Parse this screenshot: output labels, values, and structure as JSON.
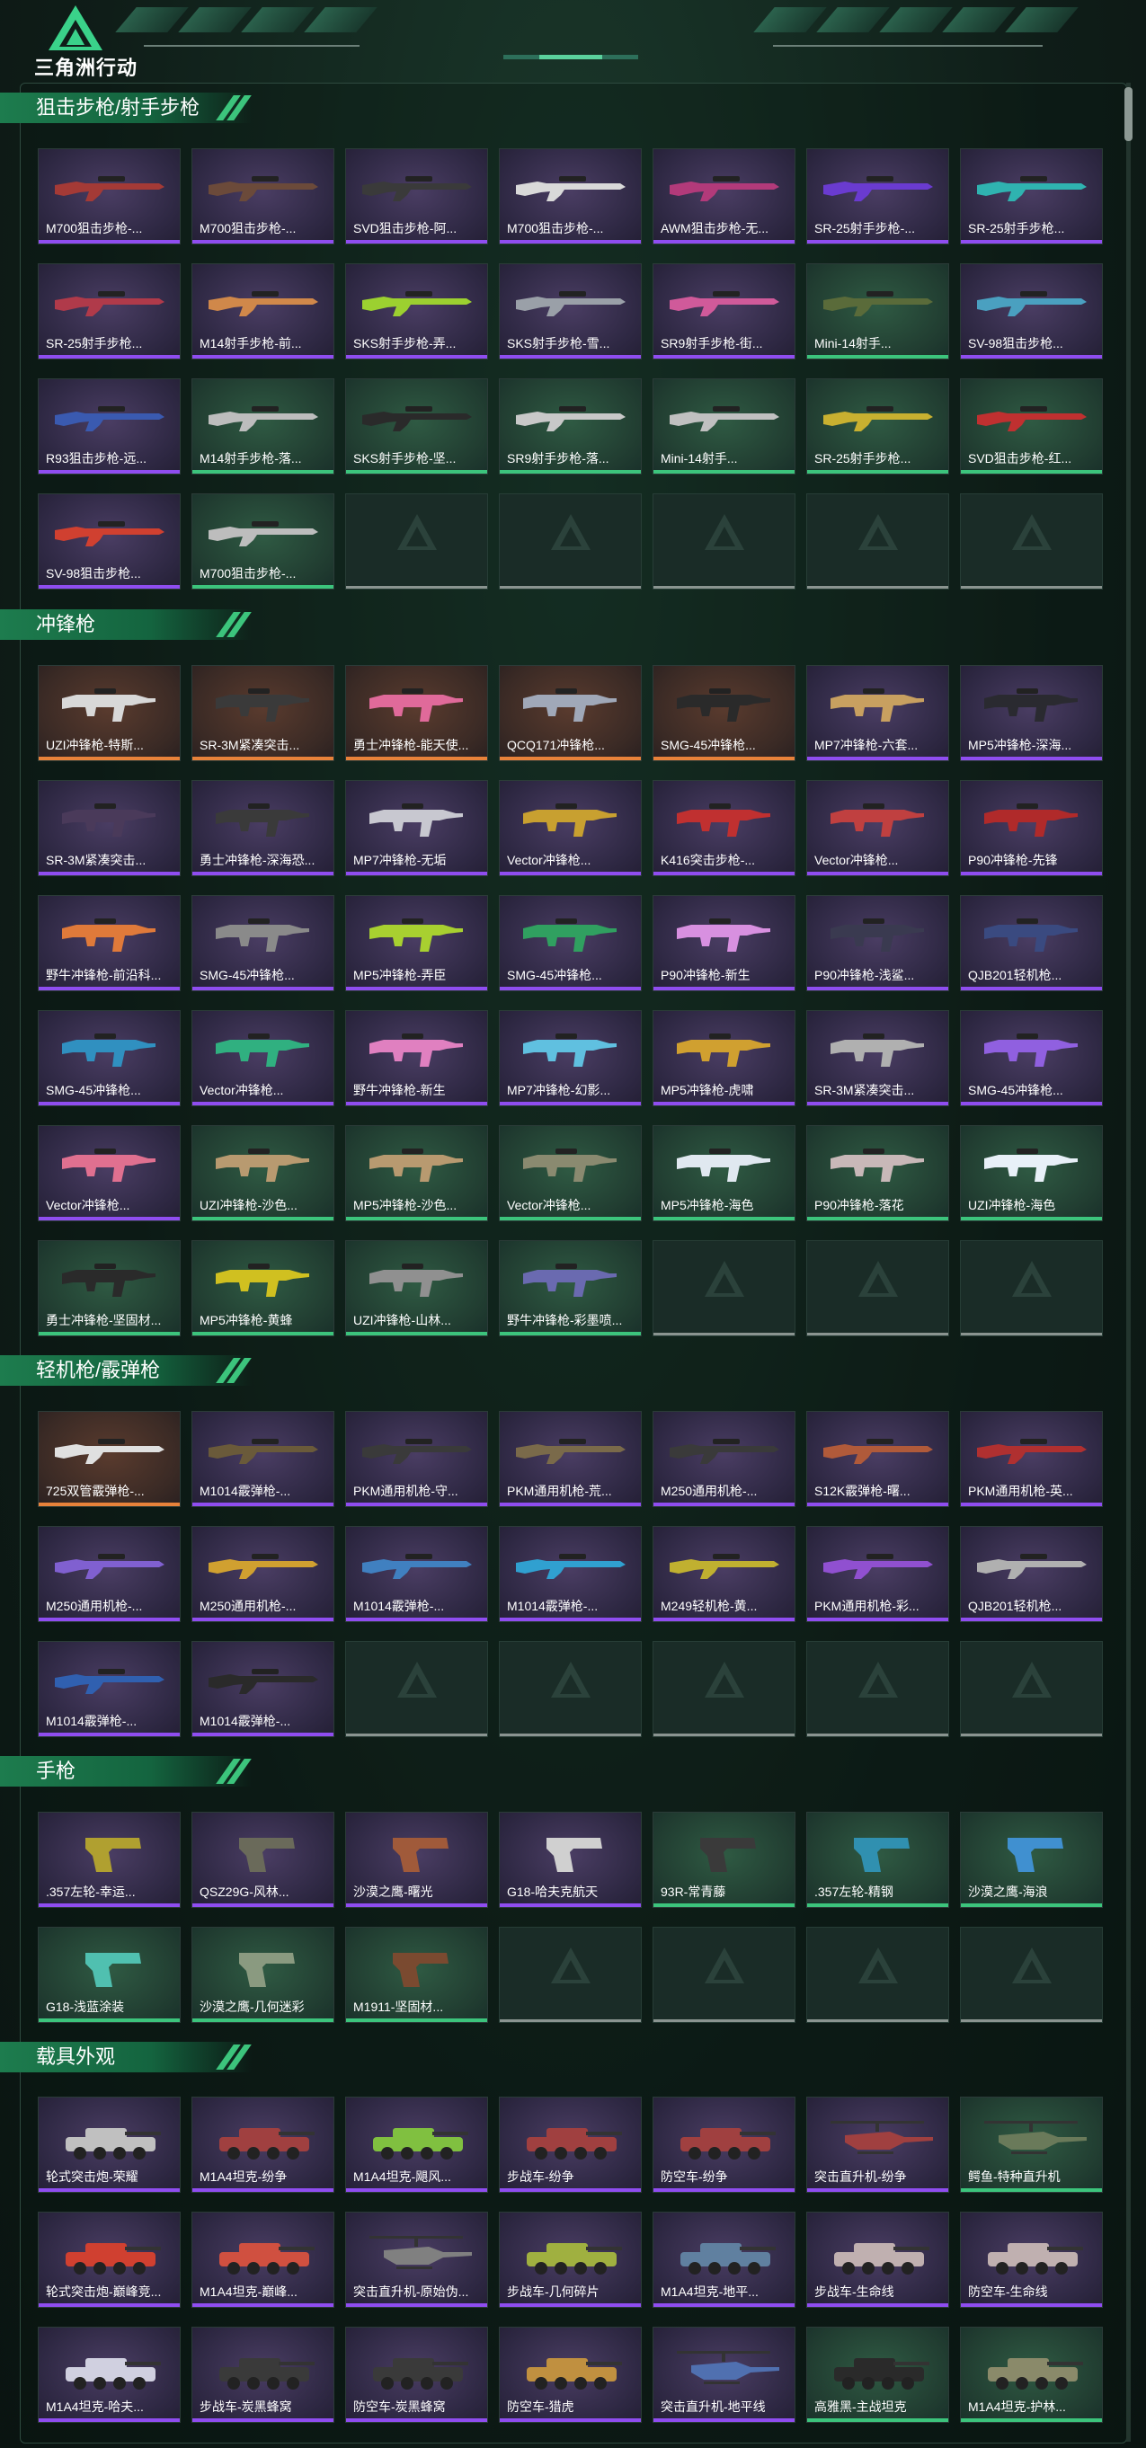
{
  "app": {
    "logo_text": "三角洲行动"
  },
  "colors": {
    "purple": "#8f4df0",
    "orange": "#e8823a",
    "green": "#3cc47c",
    "blue": "#3b6cf0",
    "accent": "#1d7c4e"
  },
  "sections": [
    {
      "title": "狙击步枪/射手步枪",
      "items": [
        {
          "name": "M700狙击步枪-...",
          "rarity": "purple",
          "kind": "rifle",
          "tone": "#a43a36"
        },
        {
          "name": "M700狙击步枪-...",
          "rarity": "purple",
          "kind": "rifle",
          "tone": "#6b4a3a"
        },
        {
          "name": "SVD狙击步枪-阿...",
          "rarity": "purple",
          "kind": "rifle",
          "tone": "#3a3a3a"
        },
        {
          "name": "M700狙击步枪-...",
          "rarity": "purple",
          "kind": "rifle",
          "tone": "#d9d9d9"
        },
        {
          "name": "AWM狙击步枪-无...",
          "rarity": "purple",
          "kind": "rifle",
          "tone": "#b23a7a"
        },
        {
          "name": "SR-25射手步枪-...",
          "rarity": "purple",
          "kind": "rifle",
          "tone": "#6a3bd0"
        },
        {
          "name": "SR-25射手步枪...",
          "rarity": "purple",
          "kind": "rifle",
          "tone": "#2fb3b0"
        },
        {
          "name": "SR-25射手步枪...",
          "rarity": "purple",
          "kind": "rifle",
          "tone": "#b03a4a"
        },
        {
          "name": "M14射手步枪-前...",
          "rarity": "purple",
          "kind": "rifle",
          "tone": "#d0884a"
        },
        {
          "name": "SKS射手步枪-弄...",
          "rarity": "purple",
          "kind": "rifle",
          "tone": "#9cd030"
        },
        {
          "name": "SKS射手步枪-雪...",
          "rarity": "purple",
          "kind": "rifle",
          "tone": "#9aa0a8"
        },
        {
          "name": "SR9射手步枪-街...",
          "rarity": "purple",
          "kind": "rifle",
          "tone": "#d05a9a"
        },
        {
          "name": "Mini-14射手...",
          "rarity": "green",
          "kind": "rifle",
          "tone": "#5a6b3a"
        },
        {
          "name": "SV-98狙击步枪...",
          "rarity": "purple",
          "kind": "rifle",
          "tone": "#4aa0c0"
        },
        {
          "name": "R93狙击步枪-远...",
          "rarity": "purple",
          "kind": "rifle",
          "tone": "#3a5ab0"
        },
        {
          "name": "M14射手步枪-落...",
          "rarity": "green",
          "kind": "rifle",
          "tone": "#bdbdbd"
        },
        {
          "name": "SKS射手步枪-坚...",
          "rarity": "green",
          "kind": "rifle",
          "tone": "#2a2a2a"
        },
        {
          "name": "SR9射手步枪-落...",
          "rarity": "green",
          "kind": "rifle",
          "tone": "#c8c8c8"
        },
        {
          "name": "Mini-14射手...",
          "rarity": "green",
          "kind": "rifle",
          "tone": "#c0c0c0"
        },
        {
          "name": "SR-25射手步枪...",
          "rarity": "green",
          "kind": "rifle",
          "tone": "#c8b030"
        },
        {
          "name": "SVD狙击步枪-红...",
          "rarity": "green",
          "kind": "rifle",
          "tone": "#c03030"
        },
        {
          "name": "SV-98狙击步枪...",
          "rarity": "purple",
          "kind": "rifle",
          "tone": "#d04030"
        },
        {
          "name": "M700狙击步枪-...",
          "rarity": "green",
          "kind": "rifle",
          "tone": "#bdbdbd"
        },
        {
          "empty": true
        },
        {
          "empty": true
        },
        {
          "empty": true
        },
        {
          "empty": true
        },
        {
          "empty": true
        }
      ]
    },
    {
      "title": "冲锋枪",
      "items": [
        {
          "name": "UZI冲锋枪-特斯...",
          "rarity": "orange",
          "kind": "smg",
          "tone": "#d8d8d8"
        },
        {
          "name": "SR-3M紧凑突击...",
          "rarity": "orange",
          "kind": "smg",
          "tone": "#3a3a3a"
        },
        {
          "name": "勇士冲锋枪-能天使...",
          "rarity": "orange",
          "kind": "smg",
          "tone": "#e06a9a"
        },
        {
          "name": "QCQ171冲锋枪...",
          "rarity": "orange",
          "kind": "smg",
          "tone": "#a0a8b8"
        },
        {
          "name": "SMG-45冲锋枪...",
          "rarity": "orange",
          "kind": "smg",
          "tone": "#2a2a2a"
        },
        {
          "name": "MP7冲锋枪-六套...",
          "rarity": "purple",
          "kind": "smg",
          "tone": "#c8a060"
        },
        {
          "name": "MP5冲锋枪-深海...",
          "rarity": "purple",
          "kind": "smg",
          "tone": "#2a2a30"
        },
        {
          "name": "SR-3M紧凑突击...",
          "rarity": "purple",
          "kind": "smg",
          "tone": "#4a3a5a"
        },
        {
          "name": "勇士冲锋枪-深海恐...",
          "rarity": "purple",
          "kind": "smg",
          "tone": "#3a3a3a"
        },
        {
          "name": "MP7冲锋枪-无垢",
          "rarity": "purple",
          "kind": "smg",
          "tone": "#c8c8d0"
        },
        {
          "name": "Vector冲锋枪...",
          "rarity": "purple",
          "kind": "smg",
          "tone": "#c8a030"
        },
        {
          "name": "K416突击步枪-...",
          "rarity": "purple",
          "kind": "smg",
          "tone": "#c03030"
        },
        {
          "name": "Vector冲锋枪...",
          "rarity": "purple",
          "kind": "smg",
          "tone": "#c04040"
        },
        {
          "name": "P90冲锋枪-先锋",
          "rarity": "purple",
          "kind": "smg",
          "tone": "#b02a2a"
        },
        {
          "name": "野牛冲锋枪-前沿科...",
          "rarity": "purple",
          "kind": "smg",
          "tone": "#e07a3a"
        },
        {
          "name": "SMG-45冲锋枪...",
          "rarity": "purple",
          "kind": "smg",
          "tone": "#8a8a8a"
        },
        {
          "name": "MP5冲锋枪-弄臣",
          "rarity": "purple",
          "kind": "smg",
          "tone": "#a8d030"
        },
        {
          "name": "SMG-45冲锋枪...",
          "rarity": "purple",
          "kind": "smg",
          "tone": "#30a060"
        },
        {
          "name": "P90冲锋枪-新生",
          "rarity": "purple",
          "kind": "smg",
          "tone": "#d890e0"
        },
        {
          "name": "P90冲锋枪-浅鲨...",
          "rarity": "purple",
          "kind": "smg",
          "tone": "#3a3a50"
        },
        {
          "name": "QJB201轻机枪...",
          "rarity": "purple",
          "kind": "smg",
          "tone": "#3a4a80"
        },
        {
          "name": "SMG-45冲锋枪...",
          "rarity": "purple",
          "kind": "smg",
          "tone": "#3090c0"
        },
        {
          "name": "Vector冲锋枪...",
          "rarity": "purple",
          "kind": "smg",
          "tone": "#30b080"
        },
        {
          "name": "野牛冲锋枪-新生",
          "rarity": "purple",
          "kind": "smg",
          "tone": "#e080c0"
        },
        {
          "name": "MP7冲锋枪-幻影...",
          "rarity": "purple",
          "kind": "smg",
          "tone": "#60c0e0"
        },
        {
          "name": "MP5冲锋枪-虎啸",
          "rarity": "purple",
          "kind": "smg",
          "tone": "#d0a030"
        },
        {
          "name": "SR-3M紧凑突击...",
          "rarity": "purple",
          "kind": "smg",
          "tone": "#b0b0b0"
        },
        {
          "name": "SMG-45冲锋枪...",
          "rarity": "purple",
          "kind": "smg",
          "tone": "#9060e0"
        },
        {
          "name": "Vector冲锋枪...",
          "rarity": "purple",
          "kind": "smg",
          "tone": "#e07090"
        },
        {
          "name": "UZI冲锋枪-沙色...",
          "rarity": "green",
          "kind": "smg",
          "tone": "#b89a70"
        },
        {
          "name": "MP5冲锋枪-沙色...",
          "rarity": "green",
          "kind": "smg",
          "tone": "#b89a70"
        },
        {
          "name": "Vector冲锋枪...",
          "rarity": "green",
          "kind": "smg",
          "tone": "#8a8a70"
        },
        {
          "name": "MP5冲锋枪-海色",
          "rarity": "green",
          "kind": "smg",
          "tone": "#e0e8f0"
        },
        {
          "name": "P90冲锋枪-落花",
          "rarity": "green",
          "kind": "smg",
          "tone": "#c8b8b8"
        },
        {
          "name": "UZI冲锋枪-海色",
          "rarity": "green",
          "kind": "smg",
          "tone": "#e8f0f8"
        },
        {
          "name": "勇士冲锋枪-坚固材...",
          "rarity": "green",
          "kind": "smg",
          "tone": "#2a2a2a"
        },
        {
          "name": "MP5冲锋枪-黄蜂",
          "rarity": "green",
          "kind": "smg",
          "tone": "#d0c020"
        },
        {
          "name": "UZI冲锋枪-山林...",
          "rarity": "green",
          "kind": "smg",
          "tone": "#909090"
        },
        {
          "name": "野牛冲锋枪-彩墨喷...",
          "rarity": "green",
          "kind": "smg",
          "tone": "#6a6ab0"
        },
        {
          "empty": true
        },
        {
          "empty": true
        },
        {
          "empty": true
        }
      ]
    },
    {
      "title": "轻机枪/霰弹枪",
      "items": [
        {
          "name": "725双管霰弹枪-...",
          "rarity": "orange",
          "kind": "rifle",
          "tone": "#e0e0e0"
        },
        {
          "name": "M1014霰弹枪-...",
          "rarity": "purple",
          "kind": "rifle",
          "tone": "#6a5a3a"
        },
        {
          "name": "PKM通用机枪-守...",
          "rarity": "purple",
          "kind": "rifle",
          "tone": "#3a3a3a"
        },
        {
          "name": "PKM通用机枪-荒...",
          "rarity": "purple",
          "kind": "rifle",
          "tone": "#7a6a4a"
        },
        {
          "name": "M250通用机枪-...",
          "rarity": "purple",
          "kind": "rifle",
          "tone": "#3a3a3a"
        },
        {
          "name": "S12K霰弹枪-曙...",
          "rarity": "purple",
          "kind": "rifle",
          "tone": "#b05a3a"
        },
        {
          "name": "PKM通用机枪-英...",
          "rarity": "purple",
          "kind": "rifle",
          "tone": "#b03030"
        },
        {
          "name": "M250通用机枪-...",
          "rarity": "purple",
          "kind": "rifle",
          "tone": "#8060d0"
        },
        {
          "name": "M250通用机枪-...",
          "rarity": "purple",
          "kind": "rifle",
          "tone": "#d0a030"
        },
        {
          "name": "M1014霰弹枪-...",
          "rarity": "purple",
          "kind": "rifle",
          "tone": "#4080c0"
        },
        {
          "name": "M1014霰弹枪-...",
          "rarity": "purple",
          "kind": "rifle",
          "tone": "#30a0d0"
        },
        {
          "name": "M249轻机枪-黄...",
          "rarity": "purple",
          "kind": "rifle",
          "tone": "#c0b030"
        },
        {
          "name": "PKM通用机枪-彩...",
          "rarity": "purple",
          "kind": "rifle",
          "tone": "#9050d0"
        },
        {
          "name": "QJB201轻机枪...",
          "rarity": "purple",
          "kind": "rifle",
          "tone": "#b0b0b0"
        },
        {
          "name": "M1014霰弹枪-...",
          "rarity": "purple",
          "kind": "rifle",
          "tone": "#3060b0"
        },
        {
          "name": "M1014霰弹枪-...",
          "rarity": "purple",
          "kind": "rifle",
          "tone": "#2a2a2a"
        },
        {
          "empty": true
        },
        {
          "empty": true
        },
        {
          "empty": true
        },
        {
          "empty": true
        },
        {
          "empty": true
        }
      ]
    },
    {
      "title": "手枪",
      "items": [
        {
          "name": ".357左轮-幸运...",
          "rarity": "purple",
          "kind": "pistol",
          "tone": "#b0a030"
        },
        {
          "name": "QSZ29G-风林...",
          "rarity": "purple",
          "kind": "pistol",
          "tone": "#6a6a5a"
        },
        {
          "name": "沙漠之鹰-曙光",
          "rarity": "purple",
          "kind": "pistol",
          "tone": "#a05a3a"
        },
        {
          "name": "G18-哈夫克航天",
          "rarity": "purple",
          "kind": "pistol",
          "tone": "#d0d0d0"
        },
        {
          "name": "93R-常青藤",
          "rarity": "green",
          "kind": "pistol",
          "tone": "#3a3a3a"
        },
        {
          "name": ".357左轮-精钢",
          "rarity": "green",
          "kind": "pistol",
          "tone": "#3090b0"
        },
        {
          "name": "沙漠之鹰-海浪",
          "rarity": "green",
          "kind": "pistol",
          "tone": "#4090d0"
        },
        {
          "name": "G18-浅蓝涂装",
          "rarity": "green",
          "kind": "pistol",
          "tone": "#50c0b0"
        },
        {
          "name": "沙漠之鹰-几何迷彩",
          "rarity": "green",
          "kind": "pistol",
          "tone": "#8a9a80"
        },
        {
          "name": "M1911-坚固材...",
          "rarity": "green",
          "kind": "pistol",
          "tone": "#7a4a30"
        },
        {
          "empty": true
        },
        {
          "empty": true
        },
        {
          "empty": true
        },
        {
          "empty": true
        }
      ]
    },
    {
      "title": "载具外观",
      "items": [
        {
          "name": "轮式突击炮-荣耀",
          "rarity": "purple",
          "kind": "vehicle",
          "tone": "#c0c0c0"
        },
        {
          "name": "M1A4坦克-纷争",
          "rarity": "purple",
          "kind": "vehicle",
          "tone": "#a04040"
        },
        {
          "name": "M1A4坦克-飓风...",
          "rarity": "purple",
          "kind": "vehicle",
          "tone": "#80c040"
        },
        {
          "name": "步战车-纷争",
          "rarity": "purple",
          "kind": "vehicle",
          "tone": "#a04040"
        },
        {
          "name": "防空车-纷争",
          "rarity": "purple",
          "kind": "vehicle",
          "tone": "#a04040"
        },
        {
          "name": "突击直升机-纷争",
          "rarity": "purple",
          "kind": "heli",
          "tone": "#a04040"
        },
        {
          "name": "鳄鱼-特种直升机",
          "rarity": "green",
          "kind": "heli",
          "tone": "#6a7a5a"
        },
        {
          "name": "轮式突击炮-巅峰竞...",
          "rarity": "purple",
          "kind": "vehicle",
          "tone": "#d04030"
        },
        {
          "name": "M1A4坦克-巅峰...",
          "rarity": "purple",
          "kind": "vehicle",
          "tone": "#d05040"
        },
        {
          "name": "突击直升机-原始伪...",
          "rarity": "purple",
          "kind": "heli",
          "tone": "#808080"
        },
        {
          "name": "步战车-几何碎片",
          "rarity": "purple",
          "kind": "vehicle",
          "tone": "#a0b040"
        },
        {
          "name": "M1A4坦克-地平...",
          "rarity": "purple",
          "kind": "vehicle",
          "tone": "#6080a0"
        },
        {
          "name": "步战车-生命线",
          "rarity": "purple",
          "kind": "vehicle",
          "tone": "#c0b0b0"
        },
        {
          "name": "防空车-生命线",
          "rarity": "purple",
          "kind": "vehicle",
          "tone": "#c0b0b0"
        },
        {
          "name": "M1A4坦克-哈夫...",
          "rarity": "purple",
          "kind": "vehicle",
          "tone": "#d0d0e0"
        },
        {
          "name": "步战车-炭黑蜂窝",
          "rarity": "purple",
          "kind": "vehicle",
          "tone": "#3a3a3a"
        },
        {
          "name": "防空车-炭黑蜂窝",
          "rarity": "purple",
          "kind": "vehicle",
          "tone": "#3a3a3a"
        },
        {
          "name": "防空车-猎虎",
          "rarity": "purple",
          "kind": "vehicle",
          "tone": "#c09040"
        },
        {
          "name": "突击直升机-地平线",
          "rarity": "purple",
          "kind": "heli",
          "tone": "#5070b0"
        },
        {
          "name": "高雅黑-主战坦克",
          "rarity": "green",
          "kind": "vehicle",
          "tone": "#2a2a2a"
        },
        {
          "name": "M1A4坦克-护林...",
          "rarity": "green",
          "kind": "vehicle",
          "tone": "#8a8a6a"
        }
      ]
    }
  ]
}
